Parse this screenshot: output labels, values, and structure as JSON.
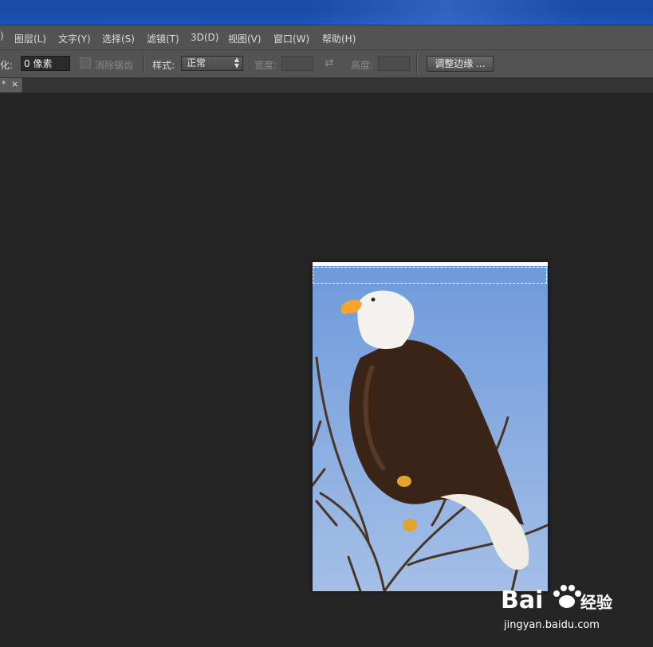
{
  "menu": {
    "items": [
      {
        "label": "图层(L)"
      },
      {
        "label": "文字(Y)"
      },
      {
        "label": "选择(S)"
      },
      {
        "label": "滤镜(T)"
      },
      {
        "label": "3D(D)"
      },
      {
        "label": "视图(V)"
      },
      {
        "label": "窗口(W)"
      },
      {
        "label": "帮助(H)"
      }
    ]
  },
  "options": {
    "feather_label": "羽化:",
    "feather_value": "0 像素",
    "antialias_label": "消除锯齿",
    "style_label": "样式:",
    "style_value": "正常",
    "width_label": "宽度:",
    "height_label": "高度:",
    "refine_edge_label": "调整边缘 ..."
  },
  "document_tab": {
    "modified_marker": "*",
    "close_label": "×"
  },
  "canvas": {
    "image_subject": "bald eagle perched on a branch against blue sky",
    "sky_color": "#7aa3dd",
    "background_color": "#252525"
  },
  "watermark": {
    "brand": "Bai",
    "brand_suffix": "经验",
    "url": "jingyan.baidu.com"
  },
  "colors": {
    "titlebar": "#1c4cae",
    "menubar": "#535353",
    "workspace": "#252525"
  }
}
